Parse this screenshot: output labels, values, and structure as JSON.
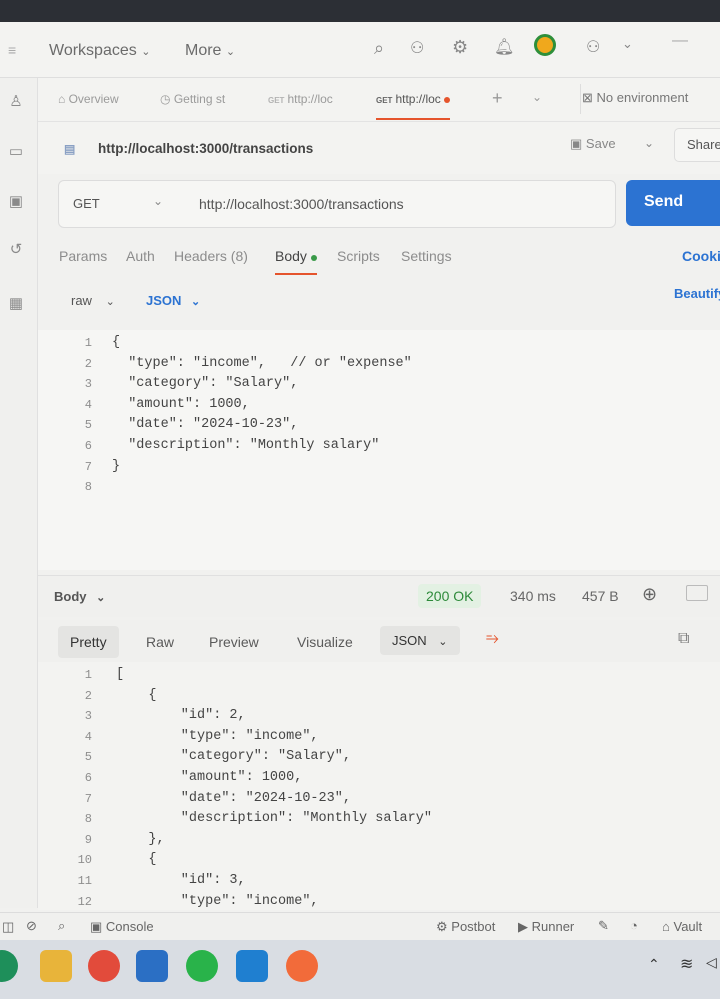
{
  "menubar": {
    "workspaces": "Workspaces",
    "more": "More"
  },
  "tabs": [
    {
      "label": "Overview"
    },
    {
      "label": "Getting st"
    },
    {
      "method": "GET",
      "label": "http://loc"
    },
    {
      "method": "GET",
      "label": "http://loc"
    }
  ],
  "environment": "No environment",
  "request": {
    "title_url": "http://localhost:3000/transactions",
    "save_label": "Save",
    "share_label": "Share",
    "method": "GET",
    "url": "http://localhost:3000/transactions",
    "send_label": "Send"
  },
  "request_tabs": {
    "params": "Params",
    "auth": "Auth",
    "headers": "Headers (8)",
    "body": "Body",
    "scripts": "Scripts",
    "settings": "Settings",
    "cookies": "Cookies"
  },
  "body_options": {
    "raw": "raw",
    "json": "JSON",
    "beautify": "Beautify"
  },
  "request_body": [
    {
      "n": "1",
      "text": "{"
    },
    {
      "n": "2",
      "text": "  \"type\": \"income\",   // or \"expense\""
    },
    {
      "n": "3",
      "text": "  \"category\": \"Salary\","
    },
    {
      "n": "4",
      "text": "  \"amount\": 1000,"
    },
    {
      "n": "5",
      "text": "  \"date\": \"2024-10-23\","
    },
    {
      "n": "6",
      "text": "  \"description\": \"Monthly salary\""
    },
    {
      "n": "7",
      "text": "}"
    },
    {
      "n": "8",
      "text": ""
    }
  ],
  "response": {
    "label": "Body",
    "status": "200 OK",
    "time": "340 ms",
    "size": "457 B",
    "tabs": {
      "pretty": "Pretty",
      "raw": "Raw",
      "preview": "Preview",
      "visualize": "Visualize",
      "format": "JSON"
    },
    "lines": [
      {
        "n": "1",
        "text": "["
      },
      {
        "n": "2",
        "text": "    {"
      },
      {
        "n": "3",
        "text": "        \"id\": 2,"
      },
      {
        "n": "4",
        "text": "        \"type\": \"income\","
      },
      {
        "n": "5",
        "text": "        \"category\": \"Salary\","
      },
      {
        "n": "6",
        "text": "        \"amount\": 1000,"
      },
      {
        "n": "7",
        "text": "        \"date\": \"2024-10-23\","
      },
      {
        "n": "8",
        "text": "        \"description\": \"Monthly salary\""
      },
      {
        "n": "9",
        "text": "    },"
      },
      {
        "n": "10",
        "text": "    {"
      },
      {
        "n": "11",
        "text": "        \"id\": 3,"
      },
      {
        "n": "12",
        "text": "        \"type\": \"income\","
      }
    ]
  },
  "footer": {
    "console": "Console",
    "postbot": "Postbot",
    "runner": "Runner",
    "vault": "Vault"
  },
  "colors": {
    "send": "#2c73d2",
    "status_ok": "#2d8a3a",
    "unsaved_dot": "#e5542c"
  }
}
